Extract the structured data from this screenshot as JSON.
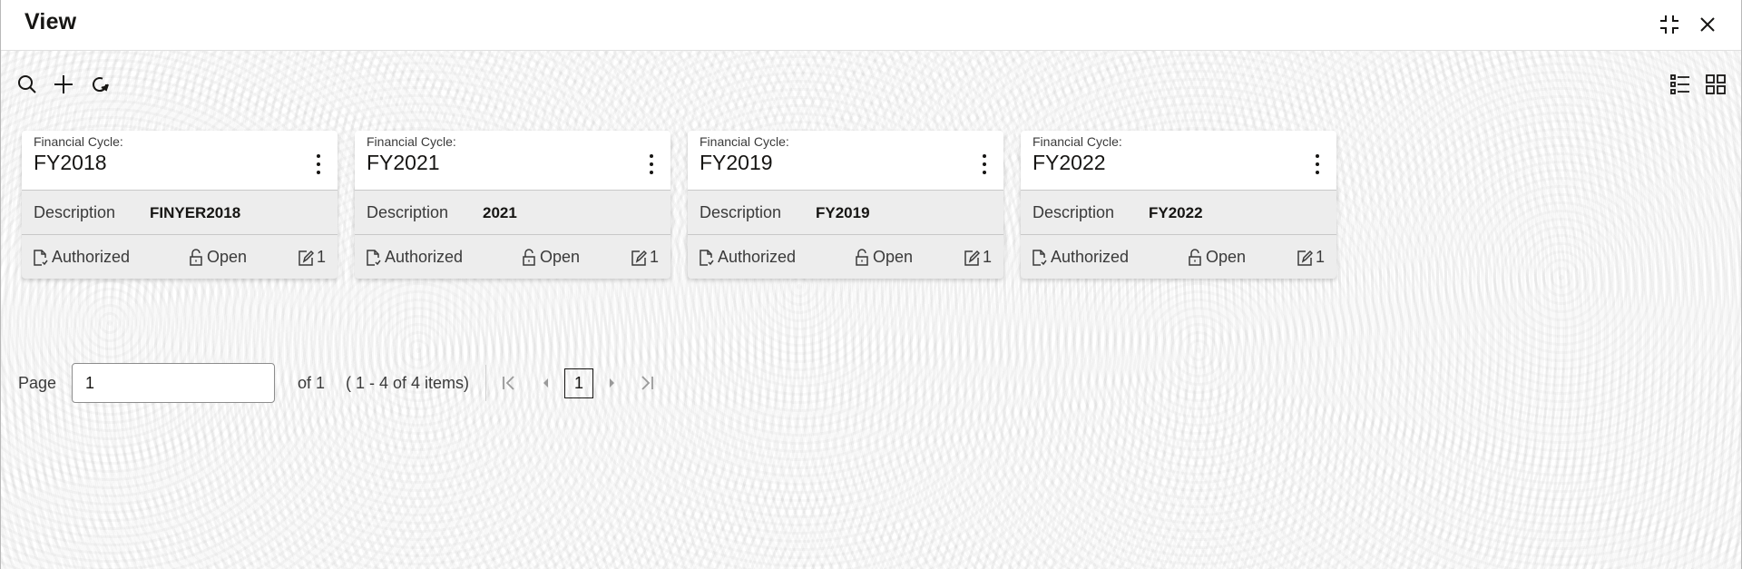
{
  "window": {
    "title": "View",
    "icons": {
      "minimize": "compress-icon",
      "close": "close-icon"
    }
  },
  "toolbar": {
    "icons": [
      "search-icon",
      "add-icon",
      "refresh-icon"
    ],
    "view_icons": [
      "list-view-icon",
      "grid-view-icon"
    ]
  },
  "cards": [
    {
      "label": "Financial Cycle:",
      "value": "FY2018",
      "description_label": "Description",
      "description": "FINYER2018",
      "auth_status": "Authorized",
      "record_status": "Open",
      "modification_count": "1"
    },
    {
      "label": "Financial Cycle:",
      "value": "FY2021",
      "description_label": "Description",
      "description": "2021",
      "auth_status": "Authorized",
      "record_status": "Open",
      "modification_count": "1"
    },
    {
      "label": "Financial Cycle:",
      "value": "FY2019",
      "description_label": "Description",
      "description": "FY2019",
      "auth_status": "Authorized",
      "record_status": "Open",
      "modification_count": "1"
    },
    {
      "label": "Financial Cycle:",
      "value": "FY2022",
      "description_label": "Description",
      "description": "FY2022",
      "auth_status": "Authorized",
      "record_status": "Open",
      "modification_count": "1"
    }
  ],
  "pagination": {
    "page_label": "Page",
    "page_value": "1",
    "of_label": "of 1",
    "range_label": "( 1 - 4 of 4 items)",
    "current_page": "1"
  }
}
